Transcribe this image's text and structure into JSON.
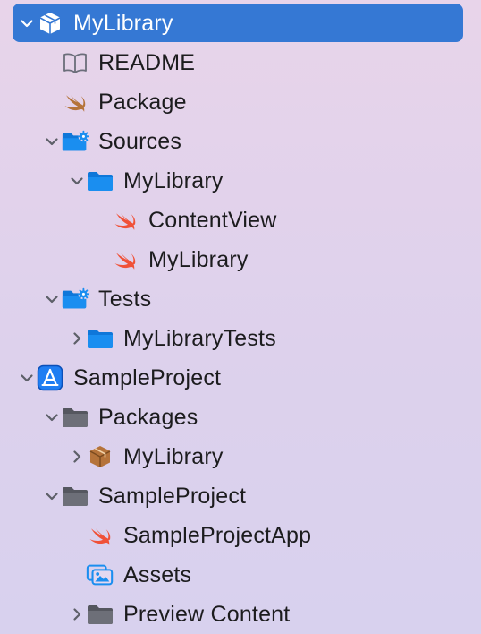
{
  "navigator": {
    "items": [
      {
        "label": "MyLibrary",
        "depth": 0,
        "disclosure": "expanded",
        "icon": "package-box-icon",
        "selected": true
      },
      {
        "label": "README",
        "depth": 1,
        "disclosure": "none",
        "icon": "book-icon"
      },
      {
        "label": "Package",
        "depth": 1,
        "disclosure": "none",
        "icon": "swift-bird-icon"
      },
      {
        "label": "Sources",
        "depth": 1,
        "disclosure": "expanded",
        "icon": "folder-gear-icon"
      },
      {
        "label": "MyLibrary",
        "depth": 2,
        "disclosure": "expanded",
        "icon": "folder-icon"
      },
      {
        "label": "ContentView",
        "depth": 3,
        "disclosure": "none",
        "icon": "swift-file-icon"
      },
      {
        "label": "MyLibrary",
        "depth": 3,
        "disclosure": "none",
        "icon": "swift-file-icon"
      },
      {
        "label": "Tests",
        "depth": 1,
        "disclosure": "expanded",
        "icon": "folder-gear-icon"
      },
      {
        "label": "MyLibraryTests",
        "depth": 2,
        "disclosure": "collapsed",
        "icon": "folder-icon"
      },
      {
        "label": "SampleProject",
        "depth": 0,
        "disclosure": "expanded",
        "icon": "xcode-project-icon"
      },
      {
        "label": "Packages",
        "depth": 1,
        "disclosure": "expanded",
        "icon": "folder-gray-icon"
      },
      {
        "label": "MyLibrary",
        "depth": 2,
        "disclosure": "collapsed",
        "icon": "package-brown-icon"
      },
      {
        "label": "SampleProject",
        "depth": 1,
        "disclosure": "expanded",
        "icon": "folder-gray-icon"
      },
      {
        "label": "SampleProjectApp",
        "depth": 2,
        "disclosure": "none",
        "icon": "swift-file-icon"
      },
      {
        "label": "Assets",
        "depth": 2,
        "disclosure": "none",
        "icon": "asset-catalog-icon"
      },
      {
        "label": "Preview Content",
        "depth": 2,
        "disclosure": "collapsed",
        "icon": "folder-gray-icon"
      }
    ]
  },
  "colors": {
    "selection": "#3578d4",
    "folder_blue": "#1a8ef0",
    "folder_gray": "#6d6f78",
    "swift_orange": "#f05138",
    "package_brown": "#b5733a"
  }
}
